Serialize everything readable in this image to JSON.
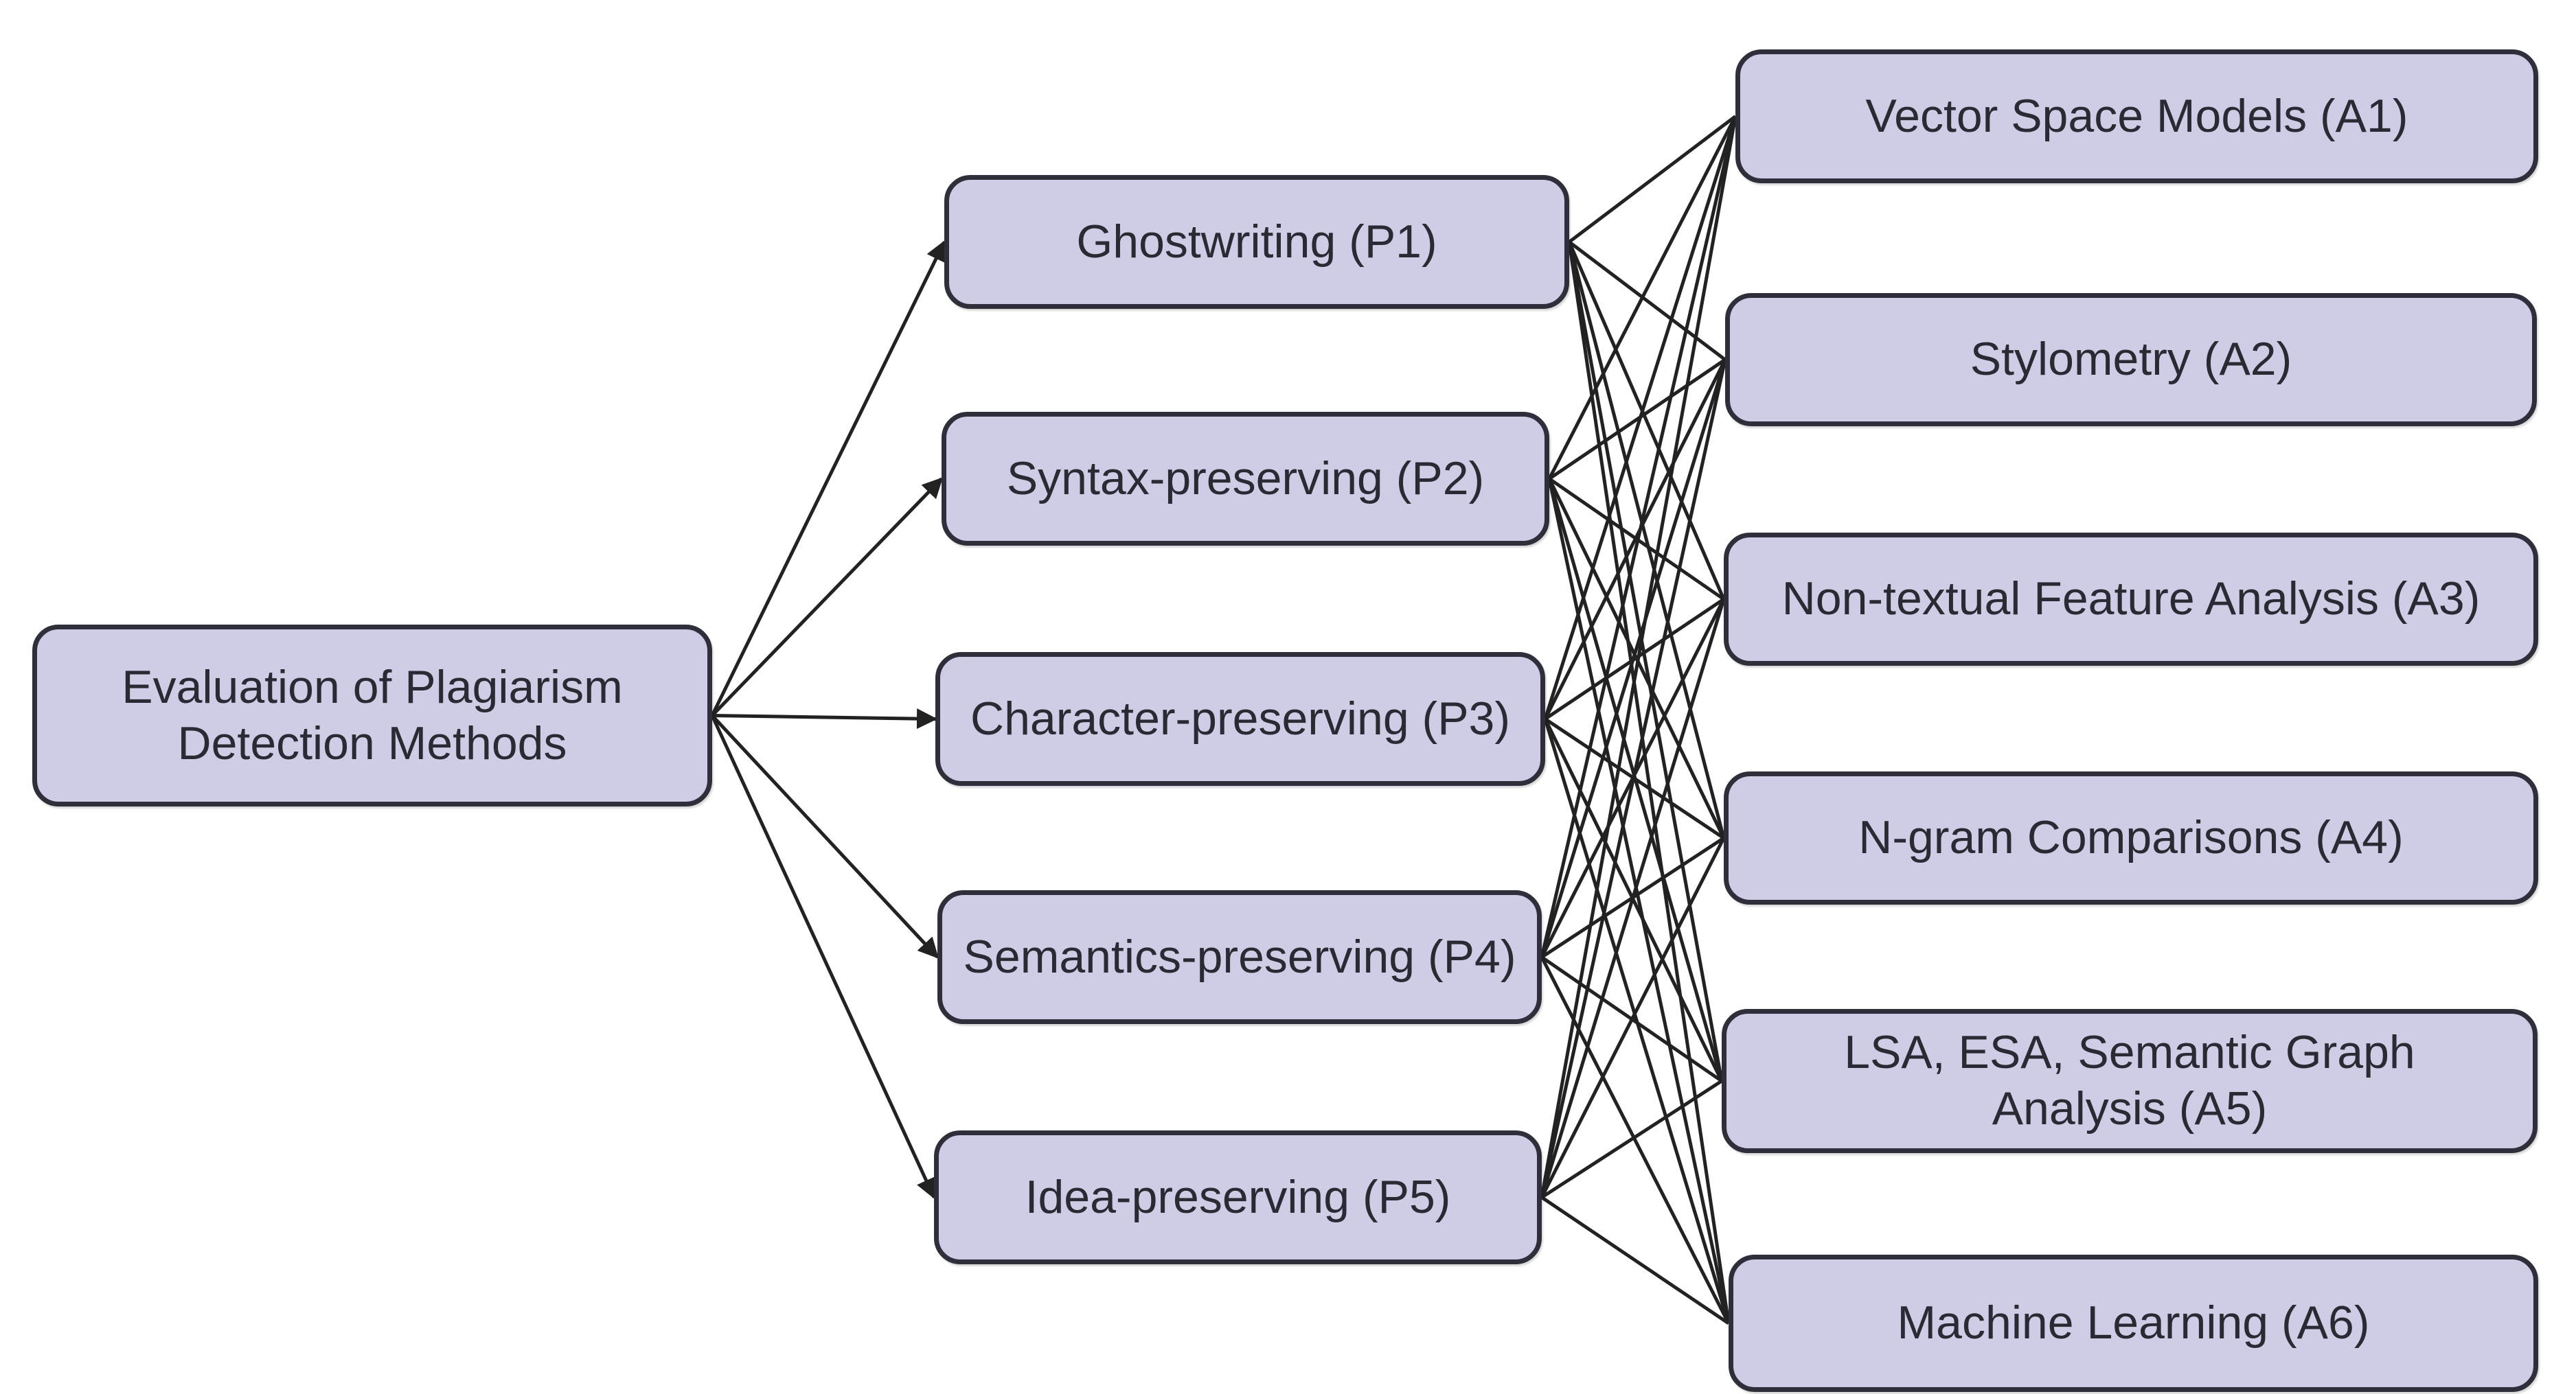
{
  "diagram": {
    "root": {
      "id": "root",
      "lines": [
        "Evaluation of Plagiarism",
        "Detection Methods"
      ]
    },
    "plagiarism_types": [
      {
        "id": "p1",
        "label": "Ghostwriting (P1)"
      },
      {
        "id": "p2",
        "label": "Syntax-preserving (P2)"
      },
      {
        "id": "p3",
        "label": "Character-preserving (P3)"
      },
      {
        "id": "p4",
        "label": "Semantics-preserving (P4)"
      },
      {
        "id": "p5",
        "label": "Idea-preserving (P5)"
      }
    ],
    "approaches": [
      {
        "id": "a1",
        "lines": [
          "Vector Space Models (A1)"
        ]
      },
      {
        "id": "a2",
        "lines": [
          "Stylometry (A2)"
        ]
      },
      {
        "id": "a3",
        "lines": [
          "Non-textual Feature Analysis (A3)"
        ]
      },
      {
        "id": "a4",
        "lines": [
          "N-gram Comparisons (A4)"
        ]
      },
      {
        "id": "a5",
        "lines": [
          "LSA, ESA, Semantic Graph",
          "Analysis (A5)"
        ]
      },
      {
        "id": "a6",
        "lines": [
          "Machine Learning (A6)"
        ]
      }
    ],
    "arrows_from_root": [
      "p1",
      "p2",
      "p3",
      "p4",
      "p5"
    ],
    "links": {
      "from": [
        "p1",
        "p2",
        "p3",
        "p4",
        "p5"
      ],
      "to": [
        "a1",
        "a2",
        "a3",
        "a4",
        "a5",
        "a6"
      ],
      "mode": "all-to-all",
      "directed": false
    },
    "colors": {
      "node_fill": "#cfcce6",
      "node_border": "#2f2f3b",
      "text": "#2a2a35",
      "edge": "#222222"
    }
  }
}
